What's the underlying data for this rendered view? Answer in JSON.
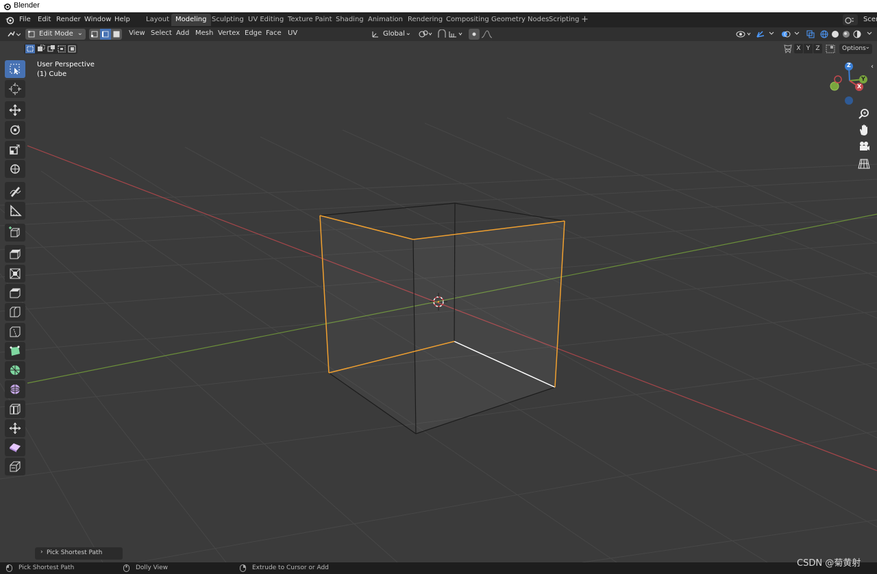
{
  "window": {
    "title": "Blender"
  },
  "menu": [
    "File",
    "Edit",
    "Render",
    "Window",
    "Help"
  ],
  "workspaces": [
    "Layout",
    "Modeling",
    "Sculpting",
    "UV Editing",
    "Texture Paint",
    "Shading",
    "Animation",
    "Rendering",
    "Compositing",
    "Geometry Nodes",
    "Scripting"
  ],
  "active_workspace": "Modeling",
  "scene_label": "Scen",
  "header": {
    "mode": "Edit Mode",
    "menus": [
      "View",
      "Select",
      "Add",
      "Mesh",
      "Vertex",
      "Edge",
      "Face",
      "UV"
    ],
    "transform_orientation": "Global",
    "axes": [
      "X",
      "Y",
      "Z"
    ],
    "options_label": "Options"
  },
  "viewport": {
    "perspective_label": "User Perspective",
    "object_label": "(1) Cube",
    "gizmo_axes": {
      "x": "X",
      "y": "Y",
      "z": "Z"
    }
  },
  "operator_panel": {
    "label": "Pick Shortest Path"
  },
  "status_bar": {
    "left": "Pick Shortest Path",
    "middle": "Dolly View",
    "right": "Extrude to Cursor or Add"
  },
  "watermark": "CSDN @菊黄射",
  "colors": {
    "selected_edge": "#f0a030",
    "x_axis": "#c4494e",
    "y_axis": "#7aa63d",
    "z_axis": "#3a7fd6",
    "active_tool": "#4772b3"
  }
}
